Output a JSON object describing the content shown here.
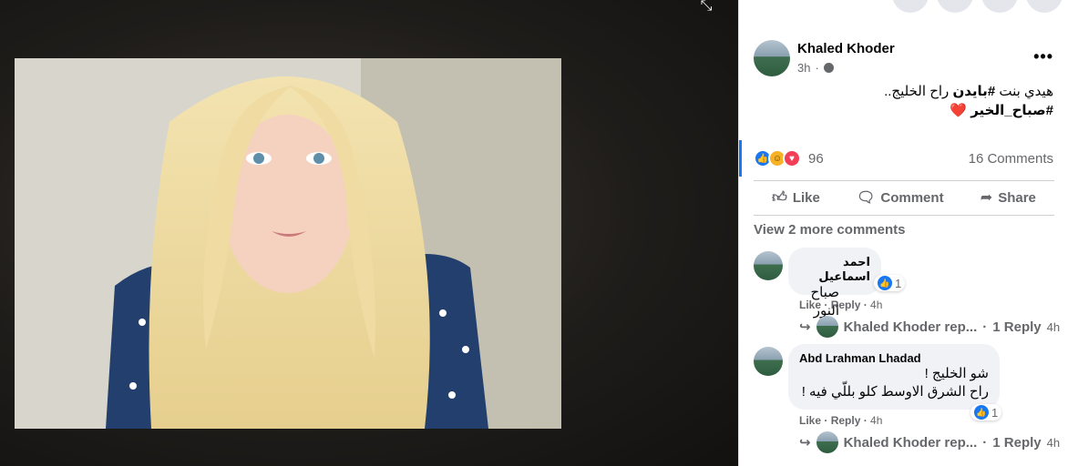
{
  "post": {
    "author": "Khaled Khoder",
    "time": "3h",
    "more": "•••",
    "text_line1_prefix": "هيدي بنت ",
    "text_line1_hashtag": "#بايدن",
    "text_line1_suffix": " راح الخليج..",
    "text_line2": "#صباح_الخير",
    "text_heart": "❤️"
  },
  "stats": {
    "reaction_count": "96",
    "comments_count": "16 Comments"
  },
  "actions": {
    "like": "Like",
    "comment": "Comment",
    "share": "Share"
  },
  "view_more": "View 2 more comments",
  "comments": [
    {
      "name": "احمد اسماعيل",
      "text": "صباح النور",
      "reactions": "1",
      "like": "Like",
      "reply": "Reply",
      "time": "4h",
      "reply_thread": {
        "author": "Khaled Khoder rep...",
        "count": "1 Reply",
        "time": "4h"
      }
    },
    {
      "name": "Abd Lrahman Lhadad",
      "text_line1": "شو الخليج !",
      "text_line2": "راح الشرق الاوسط كلو بللّي فيه !",
      "reactions": "1",
      "like": "Like",
      "reply": "Reply",
      "time": "4h",
      "reply_thread": {
        "author": "Khaled Khoder rep...",
        "count": "1 Reply",
        "time": "4h"
      }
    }
  ],
  "icons": {
    "collapse": "collapse-icon",
    "globe": "globe-icon",
    "like": "thumbs-up-icon",
    "comment": "comment-icon",
    "share": "share-icon",
    "reply_arrow": "reply-arrow-icon"
  },
  "colors": {
    "accent": "#1877f2",
    "love": "#f33e58",
    "haha": "#f7b125",
    "muted": "#65676b"
  }
}
